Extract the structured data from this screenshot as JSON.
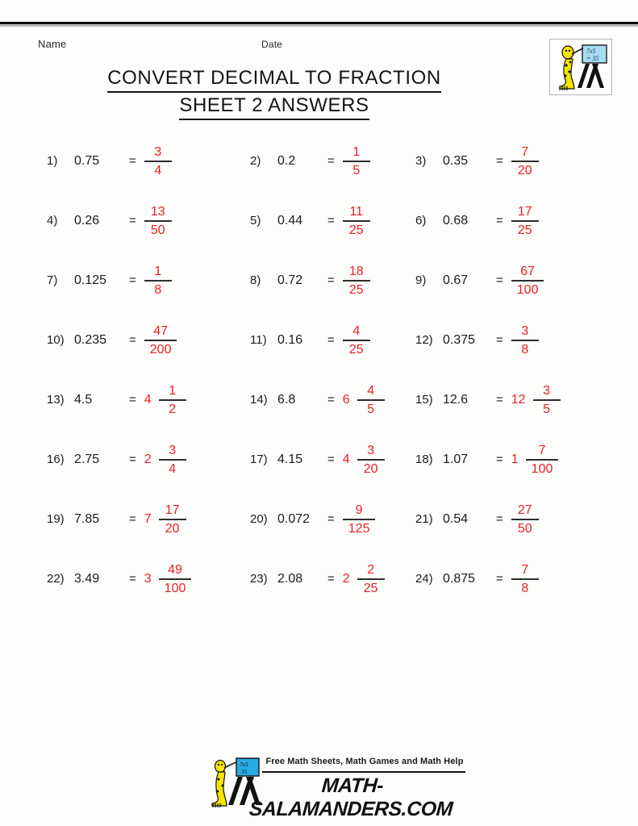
{
  "header": {
    "name_label": "Name",
    "date_label": "Date",
    "title_line1": "CONVERT DECIMAL TO FRACTION",
    "title_line2": "SHEET 2 ANSWERS",
    "logo_alt": "salamander-blackboard-logo",
    "logo_board_text_line1": "7x5",
    "logo_board_text_line2": "= 35"
  },
  "colors": {
    "answer_red": "#ed1c24",
    "text_black": "#1b1b1b",
    "rule_black": "#0b0b0b",
    "board_blue": "#9fd8f0",
    "salamander_yellow": "#f5e400"
  },
  "problems": [
    {
      "num": "1)",
      "decimal": "0.75",
      "eq": "=",
      "whole": "",
      "numerator": "3",
      "denominator": "4"
    },
    {
      "num": "2)",
      "decimal": "0.2",
      "eq": "=",
      "whole": "",
      "numerator": "1",
      "denominator": "5"
    },
    {
      "num": "3)",
      "decimal": "0.35",
      "eq": "=",
      "whole": "",
      "numerator": "7",
      "denominator": "20"
    },
    {
      "num": "4)",
      "decimal": "0.26",
      "eq": "=",
      "whole": "",
      "numerator": "13",
      "denominator": "50"
    },
    {
      "num": "5)",
      "decimal": "0.44",
      "eq": "=",
      "whole": "",
      "numerator": "11",
      "denominator": "25"
    },
    {
      "num": "6)",
      "decimal": "0.68",
      "eq": "=",
      "whole": "",
      "numerator": "17",
      "denominator": "25"
    },
    {
      "num": "7)",
      "decimal": "0.125",
      "eq": "=",
      "whole": "",
      "numerator": "1",
      "denominator": "8"
    },
    {
      "num": "8)",
      "decimal": "0.72",
      "eq": "=",
      "whole": "",
      "numerator": "18",
      "denominator": "25"
    },
    {
      "num": "9)",
      "decimal": "0.67",
      "eq": "=",
      "whole": "",
      "numerator": "67",
      "denominator": "100"
    },
    {
      "num": "10)",
      "decimal": "0.235",
      "eq": "=",
      "whole": "",
      "numerator": "47",
      "denominator": "200"
    },
    {
      "num": "11)",
      "decimal": "0.16",
      "eq": "=",
      "whole": "",
      "numerator": "4",
      "denominator": "25"
    },
    {
      "num": "12)",
      "decimal": "0.375",
      "eq": "=",
      "whole": "",
      "numerator": "3",
      "denominator": "8"
    },
    {
      "num": "13)",
      "decimal": "4.5",
      "eq": "=",
      "whole": "4",
      "numerator": "1",
      "denominator": "2"
    },
    {
      "num": "14)",
      "decimal": "6.8",
      "eq": "=",
      "whole": "6",
      "numerator": "4",
      "denominator": "5"
    },
    {
      "num": "15)",
      "decimal": "12.6",
      "eq": "=",
      "whole": "12",
      "numerator": "3",
      "denominator": "5"
    },
    {
      "num": "16)",
      "decimal": "2.75",
      "eq": "=",
      "whole": "2",
      "numerator": "3",
      "denominator": "4"
    },
    {
      "num": "17)",
      "decimal": "4.15",
      "eq": "=",
      "whole": "4",
      "numerator": "3",
      "denominator": "20"
    },
    {
      "num": "18)",
      "decimal": "1.07",
      "eq": "=",
      "whole": "1",
      "numerator": "7",
      "denominator": "100"
    },
    {
      "num": "19)",
      "decimal": "7.85",
      "eq": "=",
      "whole": "7",
      "numerator": "17",
      "denominator": "20"
    },
    {
      "num": "20)",
      "decimal": "0.072",
      "eq": "=",
      "whole": "",
      "numerator": "9",
      "denominator": "125"
    },
    {
      "num": "21)",
      "decimal": "0.54",
      "eq": "=",
      "whole": "",
      "numerator": "27",
      "denominator": "50"
    },
    {
      "num": "22)",
      "decimal": "3.49",
      "eq": "=",
      "whole": "3",
      "numerator": "49",
      "denominator": "100"
    },
    {
      "num": "23)",
      "decimal": "2.08",
      "eq": "=",
      "whole": "2",
      "numerator": "2",
      "denominator": "25"
    },
    {
      "num": "24)",
      "decimal": "0.875",
      "eq": "=",
      "whole": "",
      "numerator": "7",
      "denominator": "8"
    }
  ],
  "footer": {
    "tagline": "Free Math Sheets, Math Games and Math Help",
    "brand": "MATH-SALAMANDERS.COM",
    "logo_alt": "salamander-blackboard-logo"
  }
}
